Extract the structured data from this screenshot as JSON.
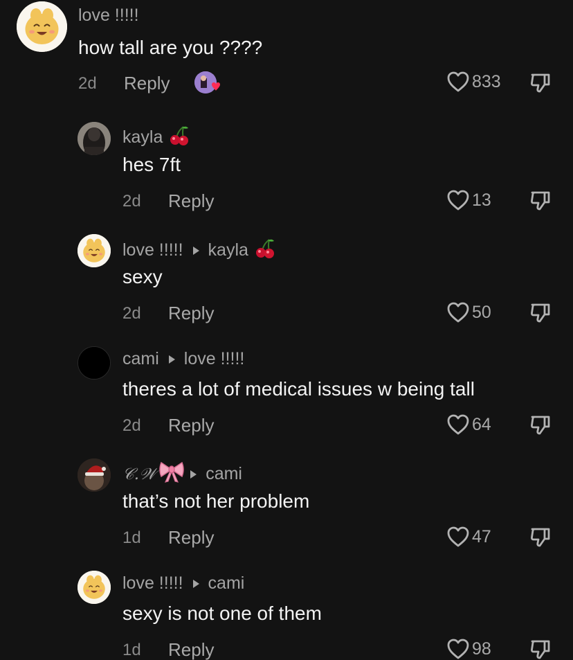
{
  "comments": [
    {
      "username": "love !!!!!",
      "reply_to": "",
      "text": "how tall are you ????",
      "age": "2d",
      "reply_label": "Reply",
      "likes": "833",
      "avatar": "smiling-bread-avatar",
      "has_creator_liked": true
    },
    {
      "username": "kayla",
      "reply_to": "",
      "text": "hes 7ft",
      "age": "2d",
      "reply_label": "Reply",
      "likes": "13",
      "avatar": "dark-photo-avatar",
      "name_emoji": "cherries-icon"
    },
    {
      "username": "love !!!!!",
      "reply_to": "kayla",
      "text": "sexy",
      "age": "2d",
      "reply_label": "Reply",
      "likes": "50",
      "avatar": "smiling-bread-avatar",
      "name_emoji": "cherries-icon"
    },
    {
      "username": "cami",
      "reply_to": "love !!!!!",
      "text": "theres a lot of medical issues w being tall",
      "age": "2d",
      "reply_label": "Reply",
      "likes": "64",
      "avatar": "black-avatar"
    },
    {
      "username": "𝒞.𝒲",
      "reply_to": "cami",
      "text": "that’s not her problem",
      "age": "1d",
      "reply_label": "Reply",
      "likes": "47",
      "avatar": "santa-hat-avatar",
      "name_emoji": "pink-bow-icon"
    },
    {
      "username": "love !!!!!",
      "reply_to": "cami",
      "text": "sexy is not one of them",
      "age": "1d",
      "reply_label": "Reply",
      "likes": "98",
      "avatar": "smiling-bread-avatar"
    }
  ],
  "colors": {
    "background": "#131313",
    "primary_text": "#f3f3f3",
    "secondary_text": "#a4a4a4",
    "heart_red": "#fe2c55"
  }
}
